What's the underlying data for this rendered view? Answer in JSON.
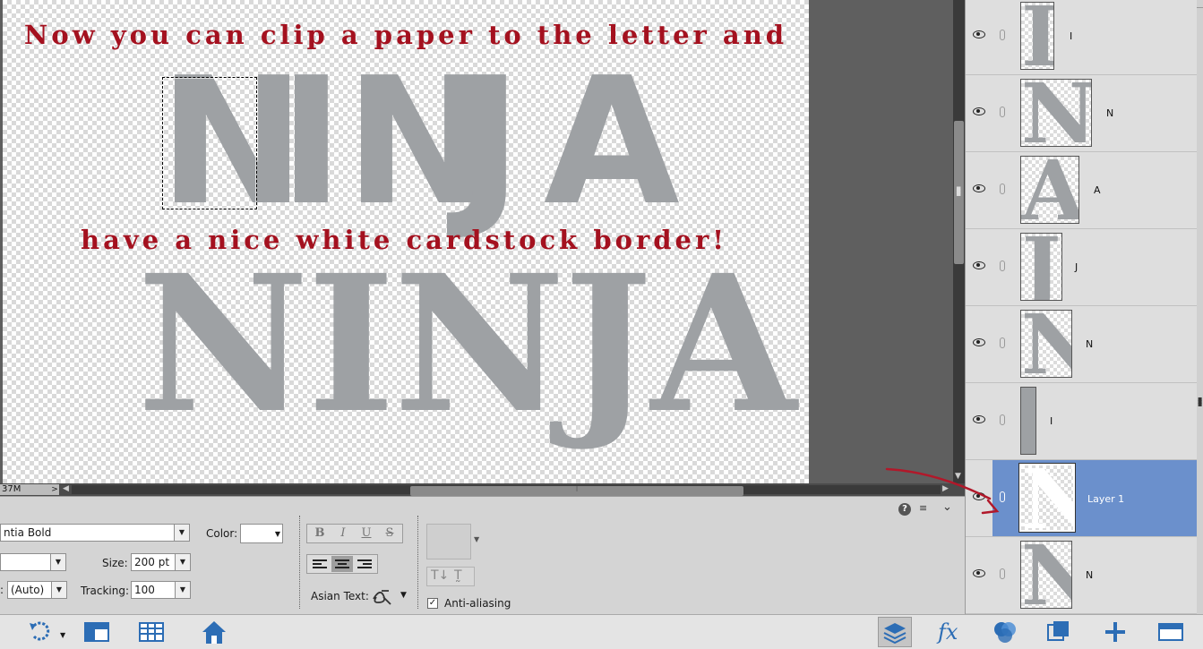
{
  "canvas": {
    "caption_top": "Now you can clip a paper to the letter and",
    "caption_bottom": "have a nice white cardstock border!",
    "word_sans_letters": [
      "N",
      "I",
      "N",
      "J",
      "A"
    ],
    "word_serif": "NINJA"
  },
  "status_bar": {
    "memory": "37M",
    "arrow": ">"
  },
  "tool_options": {
    "font_family": "ntia Bold",
    "font_style": "",
    "color_label": "Color:",
    "size_label": "Size:",
    "size_value": "200 pt",
    "leading_value": "(Auto)",
    "tracking_label": "Tracking:",
    "tracking_value": "100",
    "bold": "B",
    "italic": "I",
    "underline": "U",
    "strikethrough": "S",
    "asian_text_label": "Asian Text:",
    "anti_aliasing_label": "Anti-aliasing",
    "anti_aliasing_checked": "✓"
  },
  "layers": [
    {
      "name": "I",
      "glyph": "I",
      "selected": false
    },
    {
      "name": "N",
      "glyph": "N",
      "selected": false
    },
    {
      "name": "A",
      "glyph": "A",
      "selected": false
    },
    {
      "name": "J",
      "glyph": "J",
      "selected": false
    },
    {
      "name": "N",
      "glyph": "N",
      "selected": false
    },
    {
      "name": "I",
      "glyph": "I",
      "selected": false
    },
    {
      "name": "Layer 1",
      "glyph": "N",
      "selected": true
    },
    {
      "name": "N",
      "glyph": "N",
      "selected": false
    }
  ],
  "colors": {
    "caption": "#a4111f",
    "letters": "#9ea1a4",
    "selection_highlight": "#6b90cc",
    "annotation_arrow": "#b1182a"
  },
  "icons": {
    "help": "?",
    "panel_menu": "≡",
    "collapse": "⌄"
  }
}
